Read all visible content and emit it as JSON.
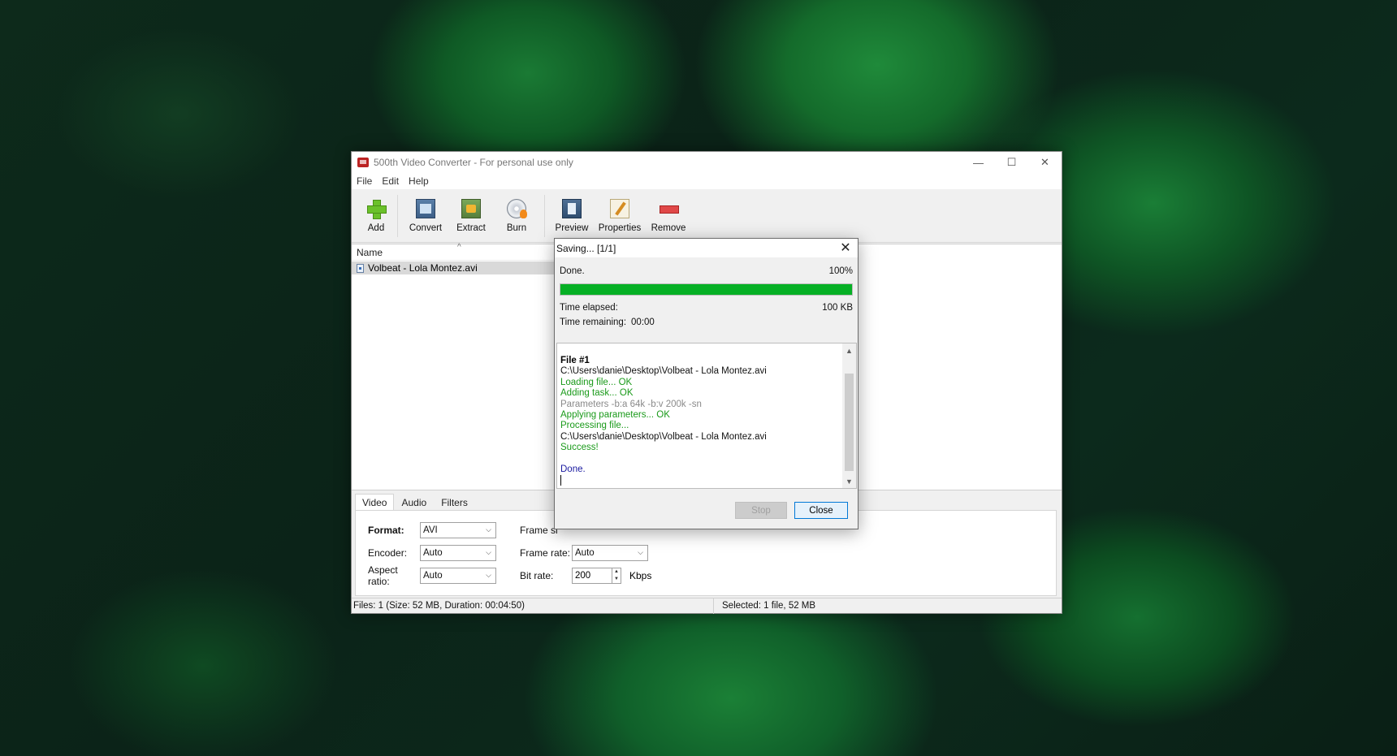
{
  "window": {
    "title": "500th Video Converter - For personal use only",
    "controls": {
      "minimize": "—",
      "maximize": "☐",
      "close": "✕"
    }
  },
  "menu": [
    "File",
    "Edit",
    "Help"
  ],
  "toolbar": [
    {
      "label": "Add",
      "icon": "add-icon"
    },
    {
      "label": "Convert",
      "icon": "convert-icon"
    },
    {
      "label": "Extract",
      "icon": "extract-icon"
    },
    {
      "label": "Burn",
      "icon": "burn-icon"
    },
    {
      "label": "Preview",
      "icon": "preview-icon"
    },
    {
      "label": "Properties",
      "icon": "properties-icon"
    },
    {
      "label": "Remove",
      "icon": "remove-icon"
    }
  ],
  "filelist": {
    "column_name": "Name",
    "sort_indicator": "^",
    "files": [
      {
        "name": "Volbeat - Lola Montez.avi"
      }
    ]
  },
  "settings": {
    "tabs": [
      "Video",
      "Audio",
      "Filters"
    ],
    "active_tab": "Video",
    "format_label": "Format:",
    "format_value": "AVI",
    "encoder_label": "Encoder:",
    "encoder_value": "Auto",
    "aspect_label": "Aspect ratio:",
    "aspect_value": "Auto",
    "frame_size_label": "Frame si",
    "frame_rate_label": "Frame rate:",
    "frame_rate_value": "Auto",
    "bitrate_label": "Bit rate:",
    "bitrate_value": "200",
    "bitrate_unit": "Kbps"
  },
  "statusbar": {
    "left": "Files: 1 (Size: 52 MB, Duration: 00:04:50)",
    "right": "Selected: 1 file, 52 MB"
  },
  "dialog": {
    "title": "Saving... [1/1]",
    "close_glyph": "✕",
    "status_text": "Done.",
    "percent_text": "100%",
    "progress": 1.0,
    "elapsed_label": "Time elapsed:",
    "size_text": "100 KB",
    "remaining_label": "Time remaining:",
    "remaining_value": "00:00",
    "log": [
      {
        "text": "File #1",
        "style": "bold"
      },
      {
        "text": "C:\\Users\\danie\\Desktop\\Volbeat - Lola Montez.avi",
        "style": "black"
      },
      {
        "text": "Loading file... OK",
        "style": "green"
      },
      {
        "text": "Adding task... OK",
        "style": "green"
      },
      {
        "text": "Parameters -b:a 64k -b:v 200k -sn",
        "style": "gray"
      },
      {
        "text": "Applying parameters... OK",
        "style": "green"
      },
      {
        "text": "Processing file...",
        "style": "green"
      },
      {
        "text": "C:\\Users\\danie\\Desktop\\Volbeat - Lola Montez.avi",
        "style": "black"
      },
      {
        "text": "Success!",
        "style": "green"
      },
      {
        "text": "",
        "style": "blank"
      },
      {
        "text": "Done.",
        "style": "blue"
      }
    ],
    "stop_label": "Stop",
    "close_label": "Close"
  }
}
